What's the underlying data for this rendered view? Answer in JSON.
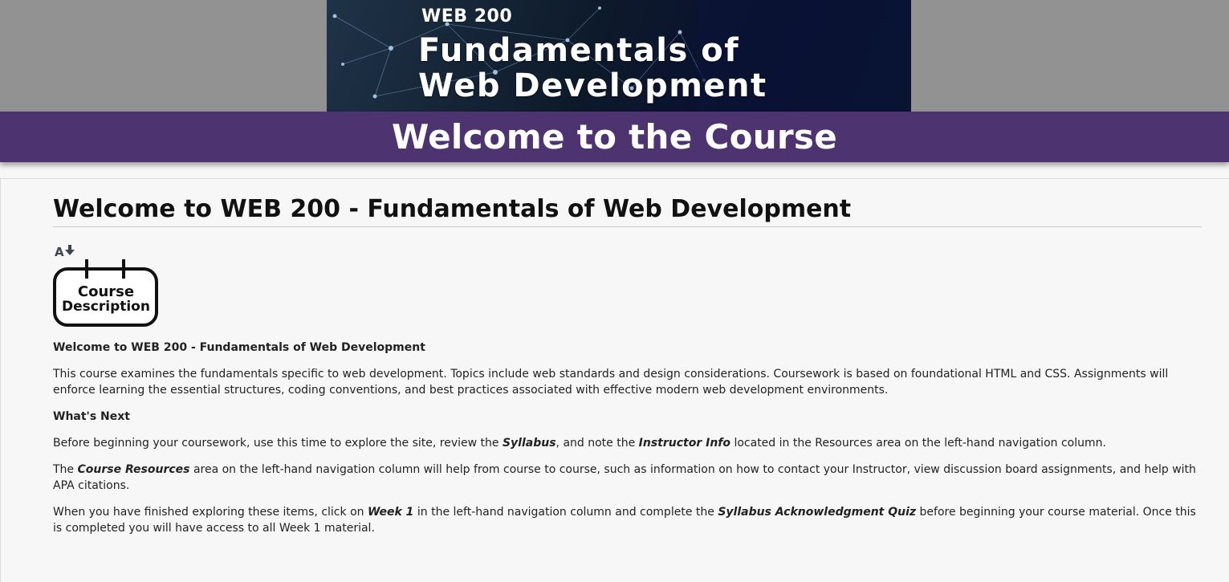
{
  "banner": {
    "course_code": "WEB 200",
    "title_line1": "Fundamentals of",
    "title_line2": "Web Development",
    "bg_accent": "#0a1030"
  },
  "welcome_bar": {
    "title": "Welcome to the Course",
    "color": "#4d3470"
  },
  "main": {
    "heading": "Welcome to WEB 200 - Fundamentals of Web Development",
    "badge_line1": "Course",
    "badge_line2": "Description",
    "font_tool_icon": "text-size-icon",
    "intro_heading": "Welcome to WEB 200 - Fundamentals of Web Development",
    "intro_text": "This course examines the fundamentals specific to web development. Topics include web standards and design considerations. Coursework is based on foundational HTML and CSS. Assignments will enforce learning the essential structures, coding conventions, and best practices associated with effective modern web development environments.",
    "next_heading": "What's Next",
    "p1_a": "Before beginning your coursework, use this time to explore the site, review the ",
    "p1_b": "Syllabus",
    "p1_c": ", and note the ",
    "p1_d": "Instructor Info",
    "p1_e": " located in the Resources area on the left-hand navigation column.",
    "p2_a": "The ",
    "p2_b": "Course Resources",
    "p2_c": " area on the left-hand navigation column will help from course to course, such as information on how to contact your Instructor, view discussion board assignments, and help with APA citations.",
    "p3_a": "When you have finished exploring these items, click on ",
    "p3_b": "Week 1",
    "p3_c": " in the left-hand navigation column and complete the ",
    "p3_d": "Syllabus Acknowledgment Quiz",
    "p3_e": " before beginning your course material. Once this is completed you will have access to all Week 1 material."
  }
}
